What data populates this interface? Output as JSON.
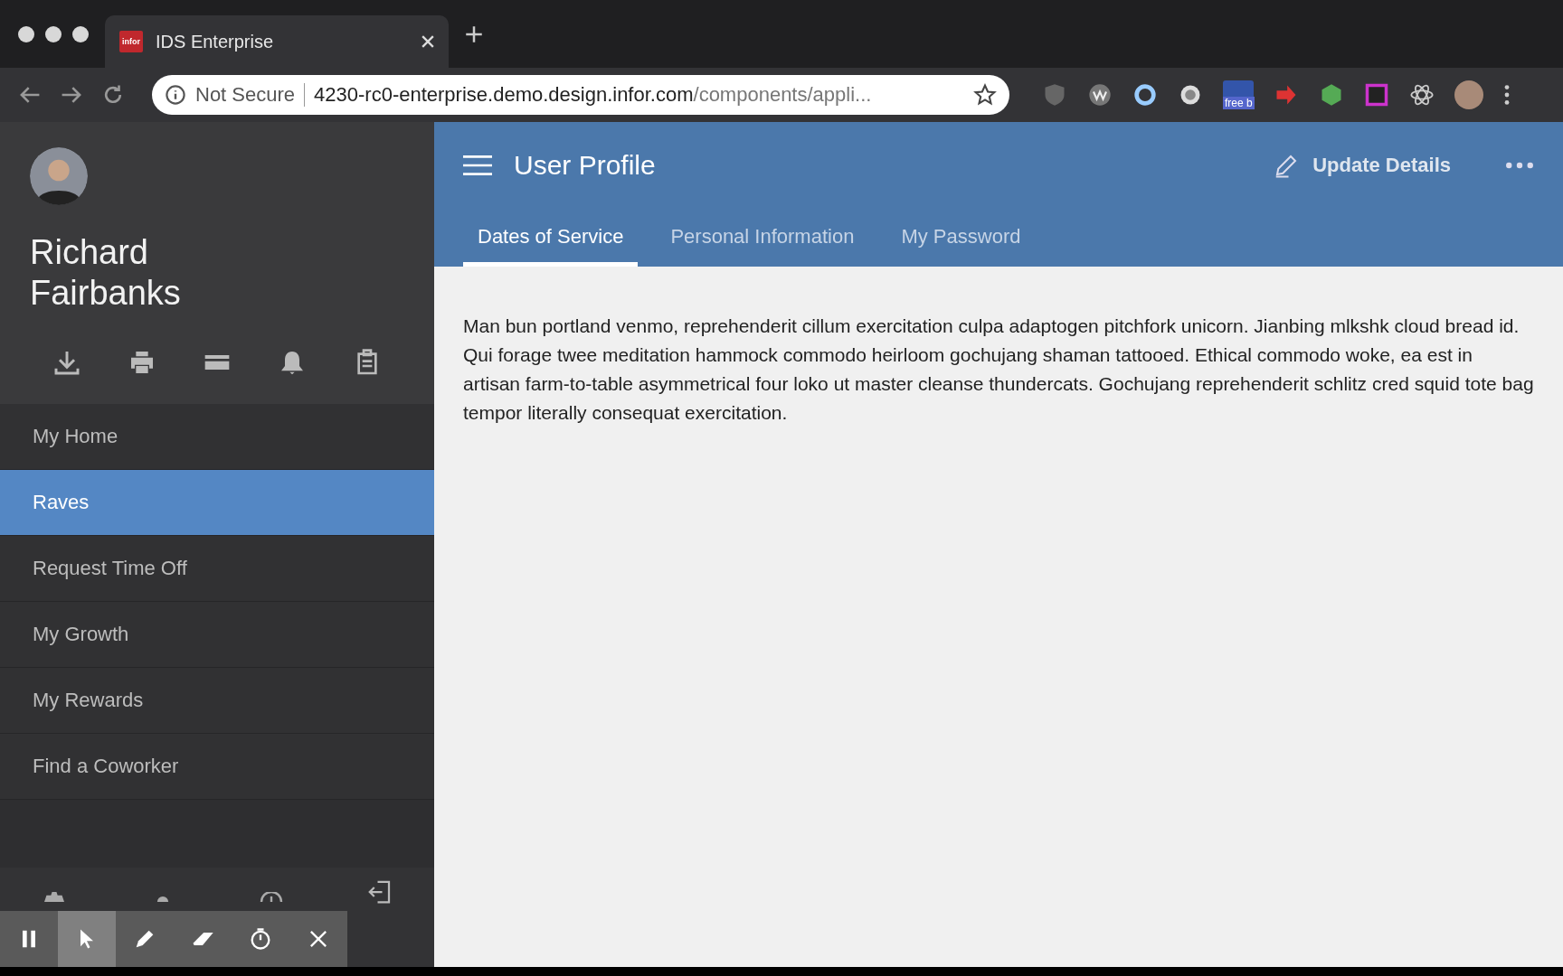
{
  "browser": {
    "tab_title": "IDS Enterprise",
    "tab_favicon": "infor",
    "security": "Not Secure",
    "url_host": "4230-rc0-enterprise.demo.design.infor.com",
    "url_path": "/components/appli...",
    "extension_badge": "free b"
  },
  "sidebar": {
    "user_name": "Richard Fairbanks",
    "items": [
      {
        "label": "My Home",
        "selected": false
      },
      {
        "label": "Raves",
        "selected": true
      },
      {
        "label": "Request Time Off",
        "selected": false
      },
      {
        "label": "My Growth",
        "selected": false
      },
      {
        "label": "My Rewards",
        "selected": false
      },
      {
        "label": "Find a Coworker",
        "selected": false
      }
    ]
  },
  "header": {
    "title": "User Profile",
    "action": "Update Details"
  },
  "tabs": [
    {
      "label": "Dates of Service",
      "selected": true
    },
    {
      "label": "Personal Information",
      "selected": false
    },
    {
      "label": "My Password",
      "selected": false
    }
  ],
  "content": {
    "paragraph": "Man bun portland venmo, reprehenderit cillum exercitation culpa adaptogen pitchfork unicorn. Jianbing mlkshk cloud bread id. Qui forage twee meditation hammock commodo heirloom gochujang shaman tattooed. Ethical commodo woke, ea est in artisan farm-to-table asymmetrical four loko ut master cleanse thundercats. Gochujang reprehenderit schlitz cred squid tote bag tempor literally consequat exercitation."
  },
  "recorder_toolbar": {
    "tools": [
      {
        "kind": "pause",
        "selected": false
      },
      {
        "kind": "cursor",
        "selected": true
      },
      {
        "kind": "pen",
        "selected": false
      },
      {
        "kind": "eraser",
        "selected": false
      },
      {
        "kind": "timer",
        "selected": false
      },
      {
        "kind": "close",
        "selected": false
      }
    ]
  }
}
